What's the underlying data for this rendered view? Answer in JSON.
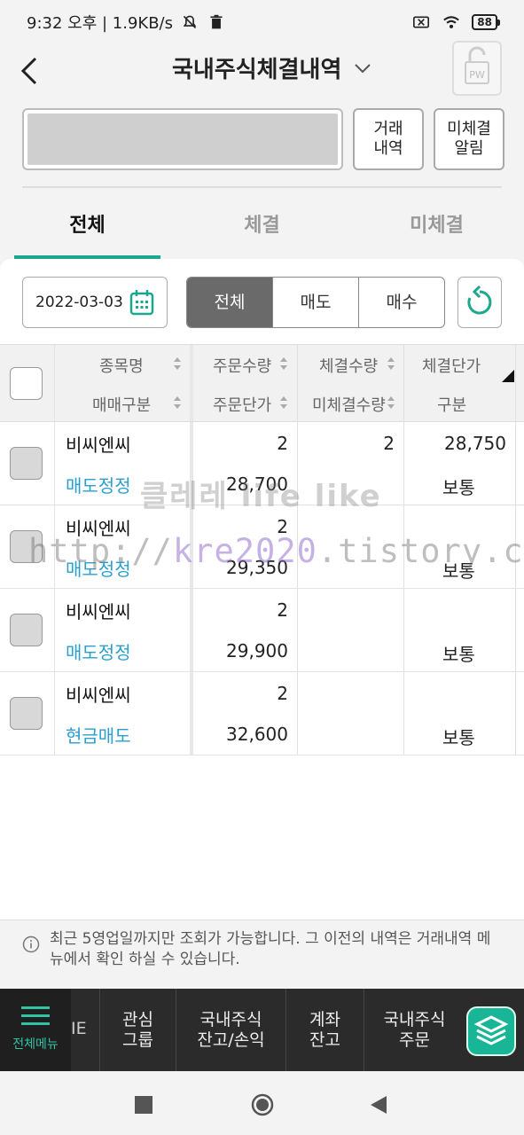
{
  "status_bar": {
    "time_speed": "9:32 오후 | 1.9KB/s",
    "battery": "88"
  },
  "header": {
    "title": "국내주식체결내역",
    "pw_label": "PW"
  },
  "actions": {
    "trade_history": "거래\n내역",
    "unfilled_alert": "미체결\n알림"
  },
  "tabs": [
    {
      "label": "전체",
      "active": true
    },
    {
      "label": "체결",
      "active": false
    },
    {
      "label": "미체결",
      "active": false
    }
  ],
  "filter": {
    "date": "2022-03-03",
    "segments": [
      "전체",
      "매도",
      "매수"
    ],
    "selected_segment": "전체"
  },
  "table": {
    "headers_row1": [
      "종목명",
      "주문수량",
      "체결수량",
      "체결단가"
    ],
    "headers_row2": [
      "매매구분",
      "주문단가",
      "미체결수량",
      "구분"
    ],
    "rows": [
      {
        "name": "비씨엔씨",
        "type": "매도정정",
        "order_qty": "2",
        "order_price": "28,700",
        "filled_qty": "2",
        "unfilled_qty": "",
        "filled_price": "28,750",
        "category": "보통"
      },
      {
        "name": "비씨엔씨",
        "type": "매도정정",
        "order_qty": "2",
        "order_price": "29,350",
        "filled_qty": "",
        "unfilled_qty": "",
        "filled_price": "",
        "category": "보통"
      },
      {
        "name": "비씨엔씨",
        "type": "매도정정",
        "order_qty": "2",
        "order_price": "29,900",
        "filled_qty": "",
        "unfilled_qty": "",
        "filled_price": "",
        "category": "보통"
      },
      {
        "name": "비씨엔씨",
        "type": "현금매도",
        "order_qty": "2",
        "order_price": "32,600",
        "filled_qty": "",
        "unfilled_qty": "",
        "filled_price": "",
        "category": "보통"
      }
    ]
  },
  "watermark": {
    "line1": "클레레 life like",
    "line2_a": "http://",
    "line2_b": "kre2020",
    "line2_c": ".tistory.com"
  },
  "notice": {
    "text": "최근 5영업일까지만 조회가 가능합니다. 그 이전의 내역은 거래내역 메뉴에서 확인 하실 수 있습니다."
  },
  "bottom_nav": {
    "menu_label": "전체메뉴",
    "fragment": "IE",
    "items": [
      "관심\n그룹",
      "국내주식\n잔고/손익",
      "계좌\n잔고",
      "국내주식\n주문"
    ]
  },
  "colors": {
    "accent": "#1aa88e",
    "link_blue": "#2a9fd0",
    "nav_bg": "#2b2b2b"
  }
}
